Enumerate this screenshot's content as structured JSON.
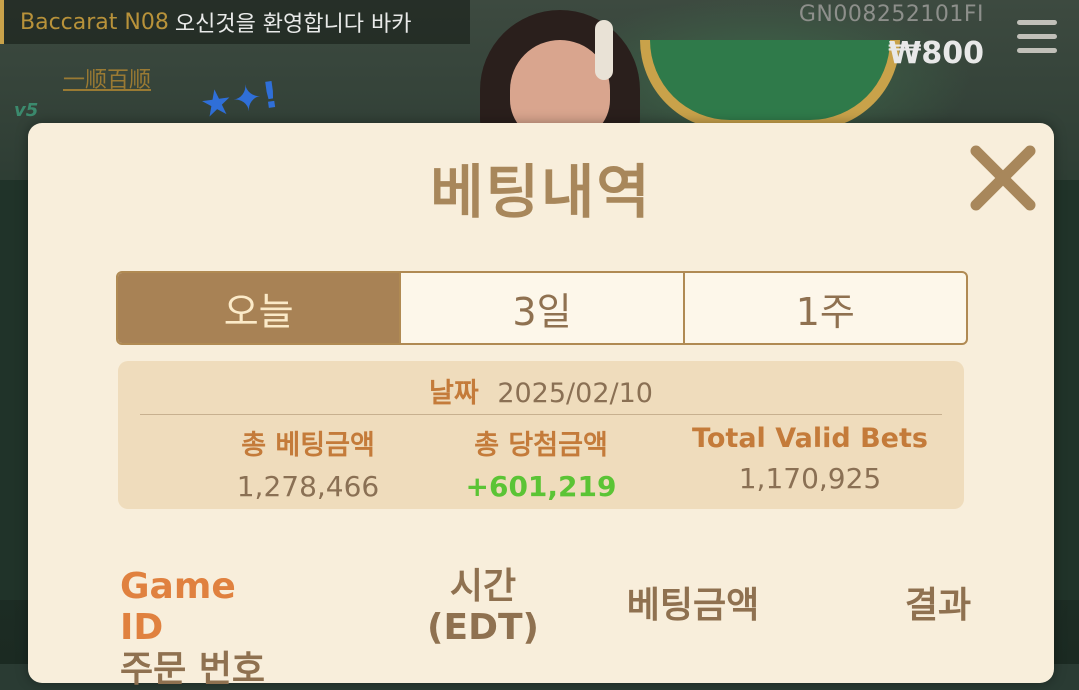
{
  "topbar": {
    "table_name": "Baccarat N08",
    "message": "오신것을 환영합니다 바카",
    "sub_link": "一顺百顺",
    "account_id": "GN008252101FI",
    "balance": "₩800"
  },
  "modal": {
    "title": "베팅내역",
    "tabs": [
      {
        "label": "오늘",
        "active": true
      },
      {
        "label": "3일",
        "active": false
      },
      {
        "label": "1주",
        "active": false
      }
    ],
    "summary": {
      "date_label": "날짜",
      "date_value": "2025/02/10",
      "total_bet_label": "총 베팅금액",
      "total_bet_value": "1,278,466",
      "total_win_label": "총 당첨금액",
      "total_win_value": "+601,219",
      "valid_bets_label": "Total Valid Bets",
      "valid_bets_value": "1,170,925"
    },
    "columns": {
      "game_id": "Game ID",
      "order_no": "주문 번호",
      "time": "시간",
      "time_zone": "(EDT)",
      "bet_amount": "베팅금액",
      "result": "결과"
    }
  },
  "colors": {
    "modal_bg": "#f8eedb",
    "accent_brown": "#a88255",
    "accent_orange": "#c47b3a",
    "win_green": "#5bc435"
  }
}
